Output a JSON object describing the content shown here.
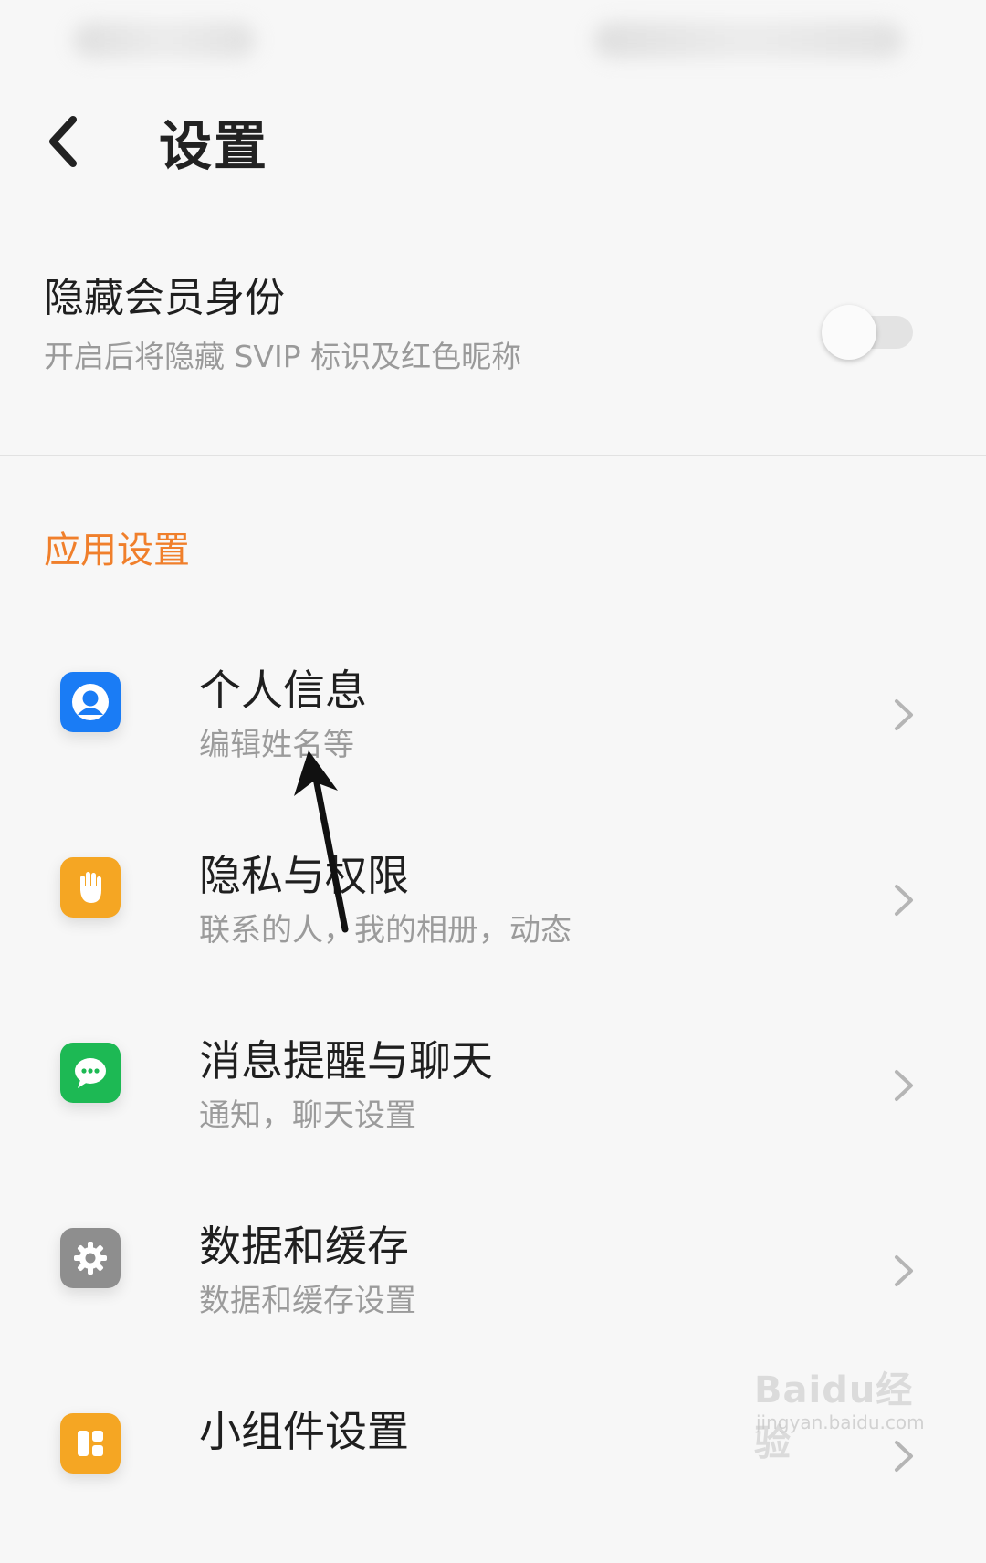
{
  "header": {
    "title": "设置"
  },
  "vip": {
    "title": "隐藏会员身份",
    "description": "开启后将隐藏 SVIP 标识及红色昵称",
    "enabled": false
  },
  "section": {
    "title": "应用设置",
    "accent_color": "#f07f2b"
  },
  "items": [
    {
      "title": "个人信息",
      "description": "编辑姓名等",
      "icon": "person-icon",
      "color": "#1a7cf5"
    },
    {
      "title": "隐私与权限",
      "description": "联系的人，我的相册，动态",
      "icon": "hand-icon",
      "color": "#f5a623"
    },
    {
      "title": "消息提醒与聊天",
      "description": "通知，聊天设置",
      "icon": "chat-icon",
      "color": "#1db954"
    },
    {
      "title": "数据和缓存",
      "description": "数据和缓存设置",
      "icon": "gear-icon",
      "color": "#8e8e8e"
    },
    {
      "title": "小组件设置",
      "description": "",
      "icon": "widget-icon",
      "color": "#f5a623"
    }
  ],
  "watermark": {
    "main": "Baidu经验",
    "sub": "jingyan.baidu.com"
  }
}
